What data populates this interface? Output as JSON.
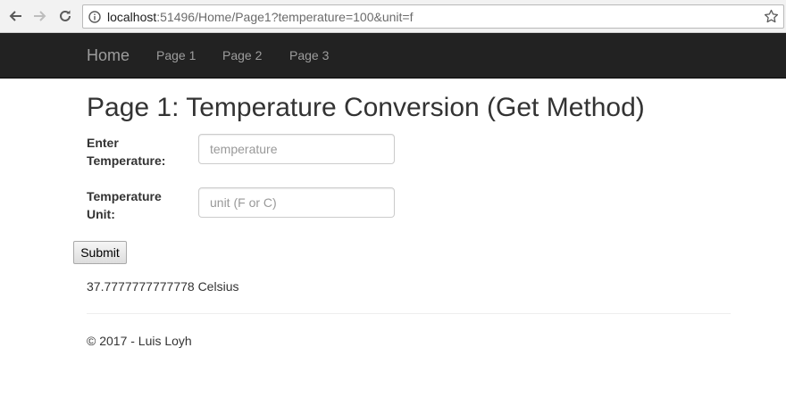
{
  "browser": {
    "url_host": "localhost",
    "url_path": ":51496/Home/Page1?temperature=100&unit=f"
  },
  "navbar": {
    "brand": "Home",
    "links": [
      "Page 1",
      "Page 2",
      "Page 3"
    ],
    "background": "#222222",
    "link_color": "#9d9d9d"
  },
  "page": {
    "title": "Page 1: Temperature Conversion (Get Method)"
  },
  "form": {
    "temperature_label": "Enter Temperature:",
    "temperature_placeholder": "temperature",
    "temperature_value": "",
    "unit_label": "Temperature Unit:",
    "unit_placeholder": "unit (F or C)",
    "unit_value": "",
    "submit_label": "Submit"
  },
  "result": {
    "text": "37.7777777777778 Celsius"
  },
  "footer": {
    "text": "© 2017 - Luis Loyh"
  },
  "icons": [
    "back-arrow-icon",
    "forward-arrow-icon",
    "reload-icon",
    "info-icon",
    "star-icon"
  ]
}
